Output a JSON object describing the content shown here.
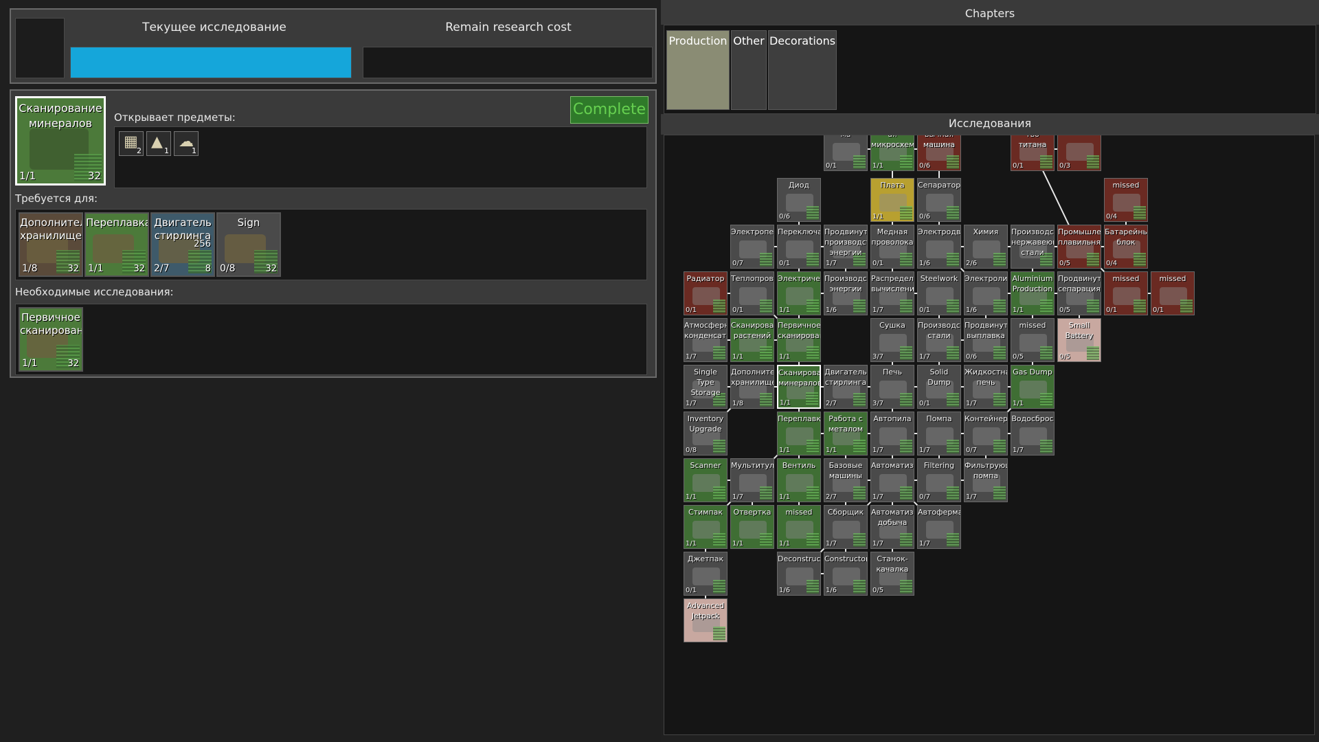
{
  "left": {
    "current_research_label": "Текущее исследование",
    "remain_cost_label": "Remain research cost",
    "progress_fraction": 1.0,
    "selected": {
      "name": "Сканирование минералов",
      "count": "1/1",
      "cost": "32"
    },
    "complete_button": "Complete",
    "unlocks_label": "Открывает предметы:",
    "unlock_items": [
      {
        "icon": "crate-icon",
        "qty": "2"
      },
      {
        "icon": "tent-icon",
        "qty": "1"
      },
      {
        "icon": "cloud-icon",
        "qty": "1"
      }
    ],
    "required_for_label": "Требуется для:",
    "required_for": [
      {
        "name": "Дополнительное хранилище",
        "count": "1/8",
        "cost": "32"
      },
      {
        "name": "Переплавка",
        "count": "1/1",
        "cost": "32"
      },
      {
        "name": "Двигатель стирлинга",
        "count": "2/7",
        "cost": "256",
        "extra": "8"
      },
      {
        "name": "Sign",
        "count": "0/8",
        "cost": "32"
      }
    ],
    "prerequisites_label": "Необходимые исследования:",
    "prerequisites": [
      {
        "name": "Первичное сканирование",
        "count": "1/1",
        "cost": "32"
      }
    ]
  },
  "right": {
    "chapters_label": "Chapters",
    "tabs": [
      "Production",
      "Other",
      "Decorations"
    ],
    "research_label": "Исследования",
    "nodes": [
      {
        "id": "n_top1",
        "name": "ма",
        "count": "0/1",
        "state": "grey"
      },
      {
        "id": "n_top2",
        "name": "ая микросхема",
        "count": "1/1",
        "state": "green"
      },
      {
        "id": "n_top3",
        "name": "вычная машина",
        "count": "0/6",
        "state": "red"
      },
      {
        "id": "n_top4",
        "name": "тво титана",
        "count": "0/1",
        "state": "red"
      },
      {
        "id": "n_top5",
        "name": "",
        "count": "0/3",
        "state": "red"
      },
      {
        "id": "n_diod",
        "name": "Диод",
        "count": "0/6",
        "state": "grey"
      },
      {
        "id": "n_plata",
        "name": "Плата",
        "count": "1/1",
        "state": "yellow"
      },
      {
        "id": "n_separ",
        "name": "Сепаратор",
        "count": "0/6",
        "state": "grey"
      },
      {
        "id": "n_missed1",
        "name": "missed",
        "count": "0/4",
        "state": "red"
      },
      {
        "id": "n_elpech",
        "name": "Электропечь",
        "count": "0/7",
        "state": "grey"
      },
      {
        "id": "n_perekl",
        "name": "Переключатель",
        "count": "0/1",
        "state": "grey"
      },
      {
        "id": "n_prodpr",
        "name": "Продвинутое производство энергии",
        "count": "1/7",
        "state": "grey"
      },
      {
        "id": "n_medn",
        "name": "Медная проволока",
        "count": "0/1",
        "state": "grey"
      },
      {
        "id": "n_elektrodv",
        "name": "Электродвигатель",
        "count": "1/6",
        "state": "grey"
      },
      {
        "id": "n_himia",
        "name": "Химия",
        "count": "2/6",
        "state": "grey"
      },
      {
        "id": "n_nerzh",
        "name": "Производство нержавеющей стали",
        "count": "",
        "state": "grey"
      },
      {
        "id": "n_prompl",
        "name": "Промышленная плавильня",
        "count": "0/5",
        "state": "red"
      },
      {
        "id": "n_batblok",
        "name": "Батарейный блок",
        "count": "0/4",
        "state": "red"
      },
      {
        "id": "n_radiator",
        "name": "Радиатор",
        "count": "0/1",
        "state": "red"
      },
      {
        "id": "n_teplo",
        "name": "Теплопроводы",
        "count": "0/1",
        "state": "grey"
      },
      {
        "id": "n_elektr",
        "name": "Электричество",
        "count": "1/1",
        "state": "green"
      },
      {
        "id": "n_prodenerg",
        "name": "Производство энергии",
        "count": "1/6",
        "state": "grey"
      },
      {
        "id": "n_raspred",
        "name": "Распределенные вычисления",
        "count": "1/7",
        "state": "grey"
      },
      {
        "id": "n_steelwork",
        "name": "Steelwork",
        "count": "0/1",
        "state": "grey"
      },
      {
        "id": "n_elektroliz",
        "name": "Электролиз",
        "count": "1/6",
        "state": "grey"
      },
      {
        "id": "n_alum",
        "name": "Aluminium Production",
        "count": "1/1",
        "state": "green"
      },
      {
        "id": "n_prodsep",
        "name": "Продвинутая сепарация",
        "count": "0/5",
        "state": "grey"
      },
      {
        "id": "n_missed2",
        "name": "missed",
        "count": "0/1",
        "state": "red"
      },
      {
        "id": "n_missed3",
        "name": "missed",
        "count": "0/1",
        "state": "red"
      },
      {
        "id": "n_atmo",
        "name": "Атмосферный конденсатор",
        "count": "1/7",
        "state": "grey"
      },
      {
        "id": "n_skanrast",
        "name": "Сканирование растений",
        "count": "1/1",
        "state": "green"
      },
      {
        "id": "n_pervskan",
        "name": "Первичное сканирование",
        "count": "1/1",
        "state": "green"
      },
      {
        "id": "n_sushka",
        "name": "Сушка",
        "count": "3/7",
        "state": "grey"
      },
      {
        "id": "n_prstali",
        "name": "Производство стали",
        "count": "1/7",
        "state": "grey"
      },
      {
        "id": "n_prodvypl",
        "name": "Продвинутая выплавка",
        "count": "0/6",
        "state": "grey"
      },
      {
        "id": "n_missed4",
        "name": "missed",
        "count": "0/5",
        "state": "grey"
      },
      {
        "id": "n_smallbat",
        "name": "Small Battery",
        "count": "0/5",
        "state": "pink"
      },
      {
        "id": "n_single",
        "name": "Single Type Storage",
        "count": "1/7",
        "state": "grey"
      },
      {
        "id": "n_dophran",
        "name": "Дополнительное хранилище",
        "count": "1/8",
        "state": "grey"
      },
      {
        "id": "n_skanmin",
        "name": "Сканирование минералов",
        "count": "1/1",
        "state": "green"
      },
      {
        "id": "n_dvigst",
        "name": "Двигатель стирлинга",
        "count": "2/7",
        "state": "grey"
      },
      {
        "id": "n_pech",
        "name": "Печь",
        "count": "3/7",
        "state": "grey"
      },
      {
        "id": "n_solid",
        "name": "Solid Dump",
        "count": "0/1",
        "state": "grey"
      },
      {
        "id": "n_zhidpech",
        "name": "Жидкостная печь",
        "count": "1/7",
        "state": "grey"
      },
      {
        "id": "n_gasdump",
        "name": "Gas Dump",
        "count": "1/1",
        "state": "green"
      },
      {
        "id": "n_invup",
        "name": "Inventory Upgrade",
        "count": "0/8",
        "state": "grey"
      },
      {
        "id": "n_pereplav",
        "name": "Переплавка",
        "count": "1/1",
        "state": "green"
      },
      {
        "id": "n_rabmet",
        "name": "Работа с металом",
        "count": "1/1",
        "state": "green"
      },
      {
        "id": "n_avtopila",
        "name": "Автопила",
        "count": "1/7",
        "state": "grey"
      },
      {
        "id": "n_pompa",
        "name": "Помпа",
        "count": "1/7",
        "state": "grey"
      },
      {
        "id": "n_kontein",
        "name": "Контейнер",
        "count": "0/7",
        "state": "grey"
      },
      {
        "id": "n_vodosbros",
        "name": "Водосброс",
        "count": "1/7",
        "state": "grey"
      },
      {
        "id": "n_scanner",
        "name": "Scanner",
        "count": "1/1",
        "state": "green"
      },
      {
        "id": "n_multitul",
        "name": "Мультитул",
        "count": "1/7",
        "state": "grey"
      },
      {
        "id": "n_ventil",
        "name": "Вентиль",
        "count": "1/1",
        "state": "green"
      },
      {
        "id": "n_bazmash",
        "name": "Базовые машины",
        "count": "2/7",
        "state": "grey"
      },
      {
        "id": "n_avtomatiz",
        "name": "Автоматизация",
        "count": "1/7",
        "state": "grey"
      },
      {
        "id": "n_filtering",
        "name": "Filtering",
        "count": "0/7",
        "state": "grey"
      },
      {
        "id": "n_filtrpompa",
        "name": "Фильтрующая помпа",
        "count": "1/7",
        "state": "grey"
      },
      {
        "id": "n_stimpak",
        "name": "Стимпак",
        "count": "1/1",
        "state": "green"
      },
      {
        "id": "n_otvertka",
        "name": "Отвертка",
        "count": "1/1",
        "state": "green"
      },
      {
        "id": "n_missed5",
        "name": "missed",
        "count": "1/1",
        "state": "green"
      },
      {
        "id": "n_sborshik",
        "name": "Сборщик",
        "count": "1/7",
        "state": "grey"
      },
      {
        "id": "n_avtodob",
        "name": "Автоматизированная добыча",
        "count": "1/7",
        "state": "grey"
      },
      {
        "id": "n_avtoferm",
        "name": "Автоферма",
        "count": "1/7",
        "state": "grey"
      },
      {
        "id": "n_jetpack",
        "name": "Джетпак",
        "count": "0/1",
        "state": "grey"
      },
      {
        "id": "n_deconstr",
        "name": "Deconstructor",
        "count": "1/6",
        "state": "grey"
      },
      {
        "id": "n_constr",
        "name": "Constructor",
        "count": "1/6",
        "state": "grey"
      },
      {
        "id": "n_stanok",
        "name": "Станок-качалка",
        "count": "0/5",
        "state": "grey"
      },
      {
        "id": "n_advjet",
        "name": "Advanced Jetpack",
        "count": "",
        "state": "pink"
      }
    ]
  }
}
